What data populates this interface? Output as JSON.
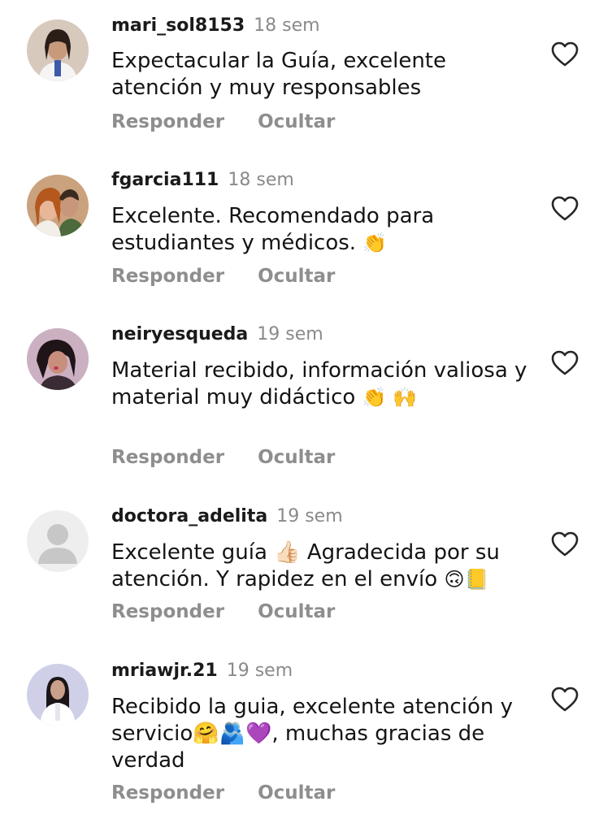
{
  "comments": [
    {
      "username": "mari_sol8153",
      "time": "18 sem",
      "text": "Expectacular la Guía, excelente atención y muy responsables",
      "emoji": "",
      "reply_label": "Responder",
      "hide_label": "Ocultar"
    },
    {
      "username": "fgarcia111",
      "time": "18 sem",
      "text": "Excelente. Recomendado para estudiantes y médicos.",
      "emoji": "👏",
      "reply_label": "Responder",
      "hide_label": "Ocultar"
    },
    {
      "username": "neiryesqueda",
      "time": "19 sem",
      "text": "Material recibido, información valiosa y material muy didáctico",
      "emoji": "👏 🙌",
      "reply_label": "Responder",
      "hide_label": "Ocultar"
    },
    {
      "username": "doctora_adelita",
      "time": "19 sem",
      "text": "Excelente guía 👍🏻 Agradecida por su atención. Y rapidez en el envío",
      "emoji": "🙃📒",
      "reply_label": "Responder",
      "hide_label": "Ocultar"
    },
    {
      "username": "mriawjr.21",
      "time": "19 sem",
      "text": "Recibido la guia, excelente atención y servicio🤗🫂💜, muchas gracias de verdad",
      "emoji": "",
      "reply_label": "Responder",
      "hide_label": "Ocultar"
    }
  ],
  "icons": {
    "like": "heart-outline-icon",
    "default_avatar": "user-silhouette-icon"
  },
  "colors": {
    "username": "#1a1a1a",
    "meta_gray": "#8a8a8a",
    "action_gray": "#8e8e8e",
    "heart_stroke": "#262626",
    "default_avatar_bg": "#eeeeee",
    "default_avatar_fg": "#c7c7c7"
  }
}
